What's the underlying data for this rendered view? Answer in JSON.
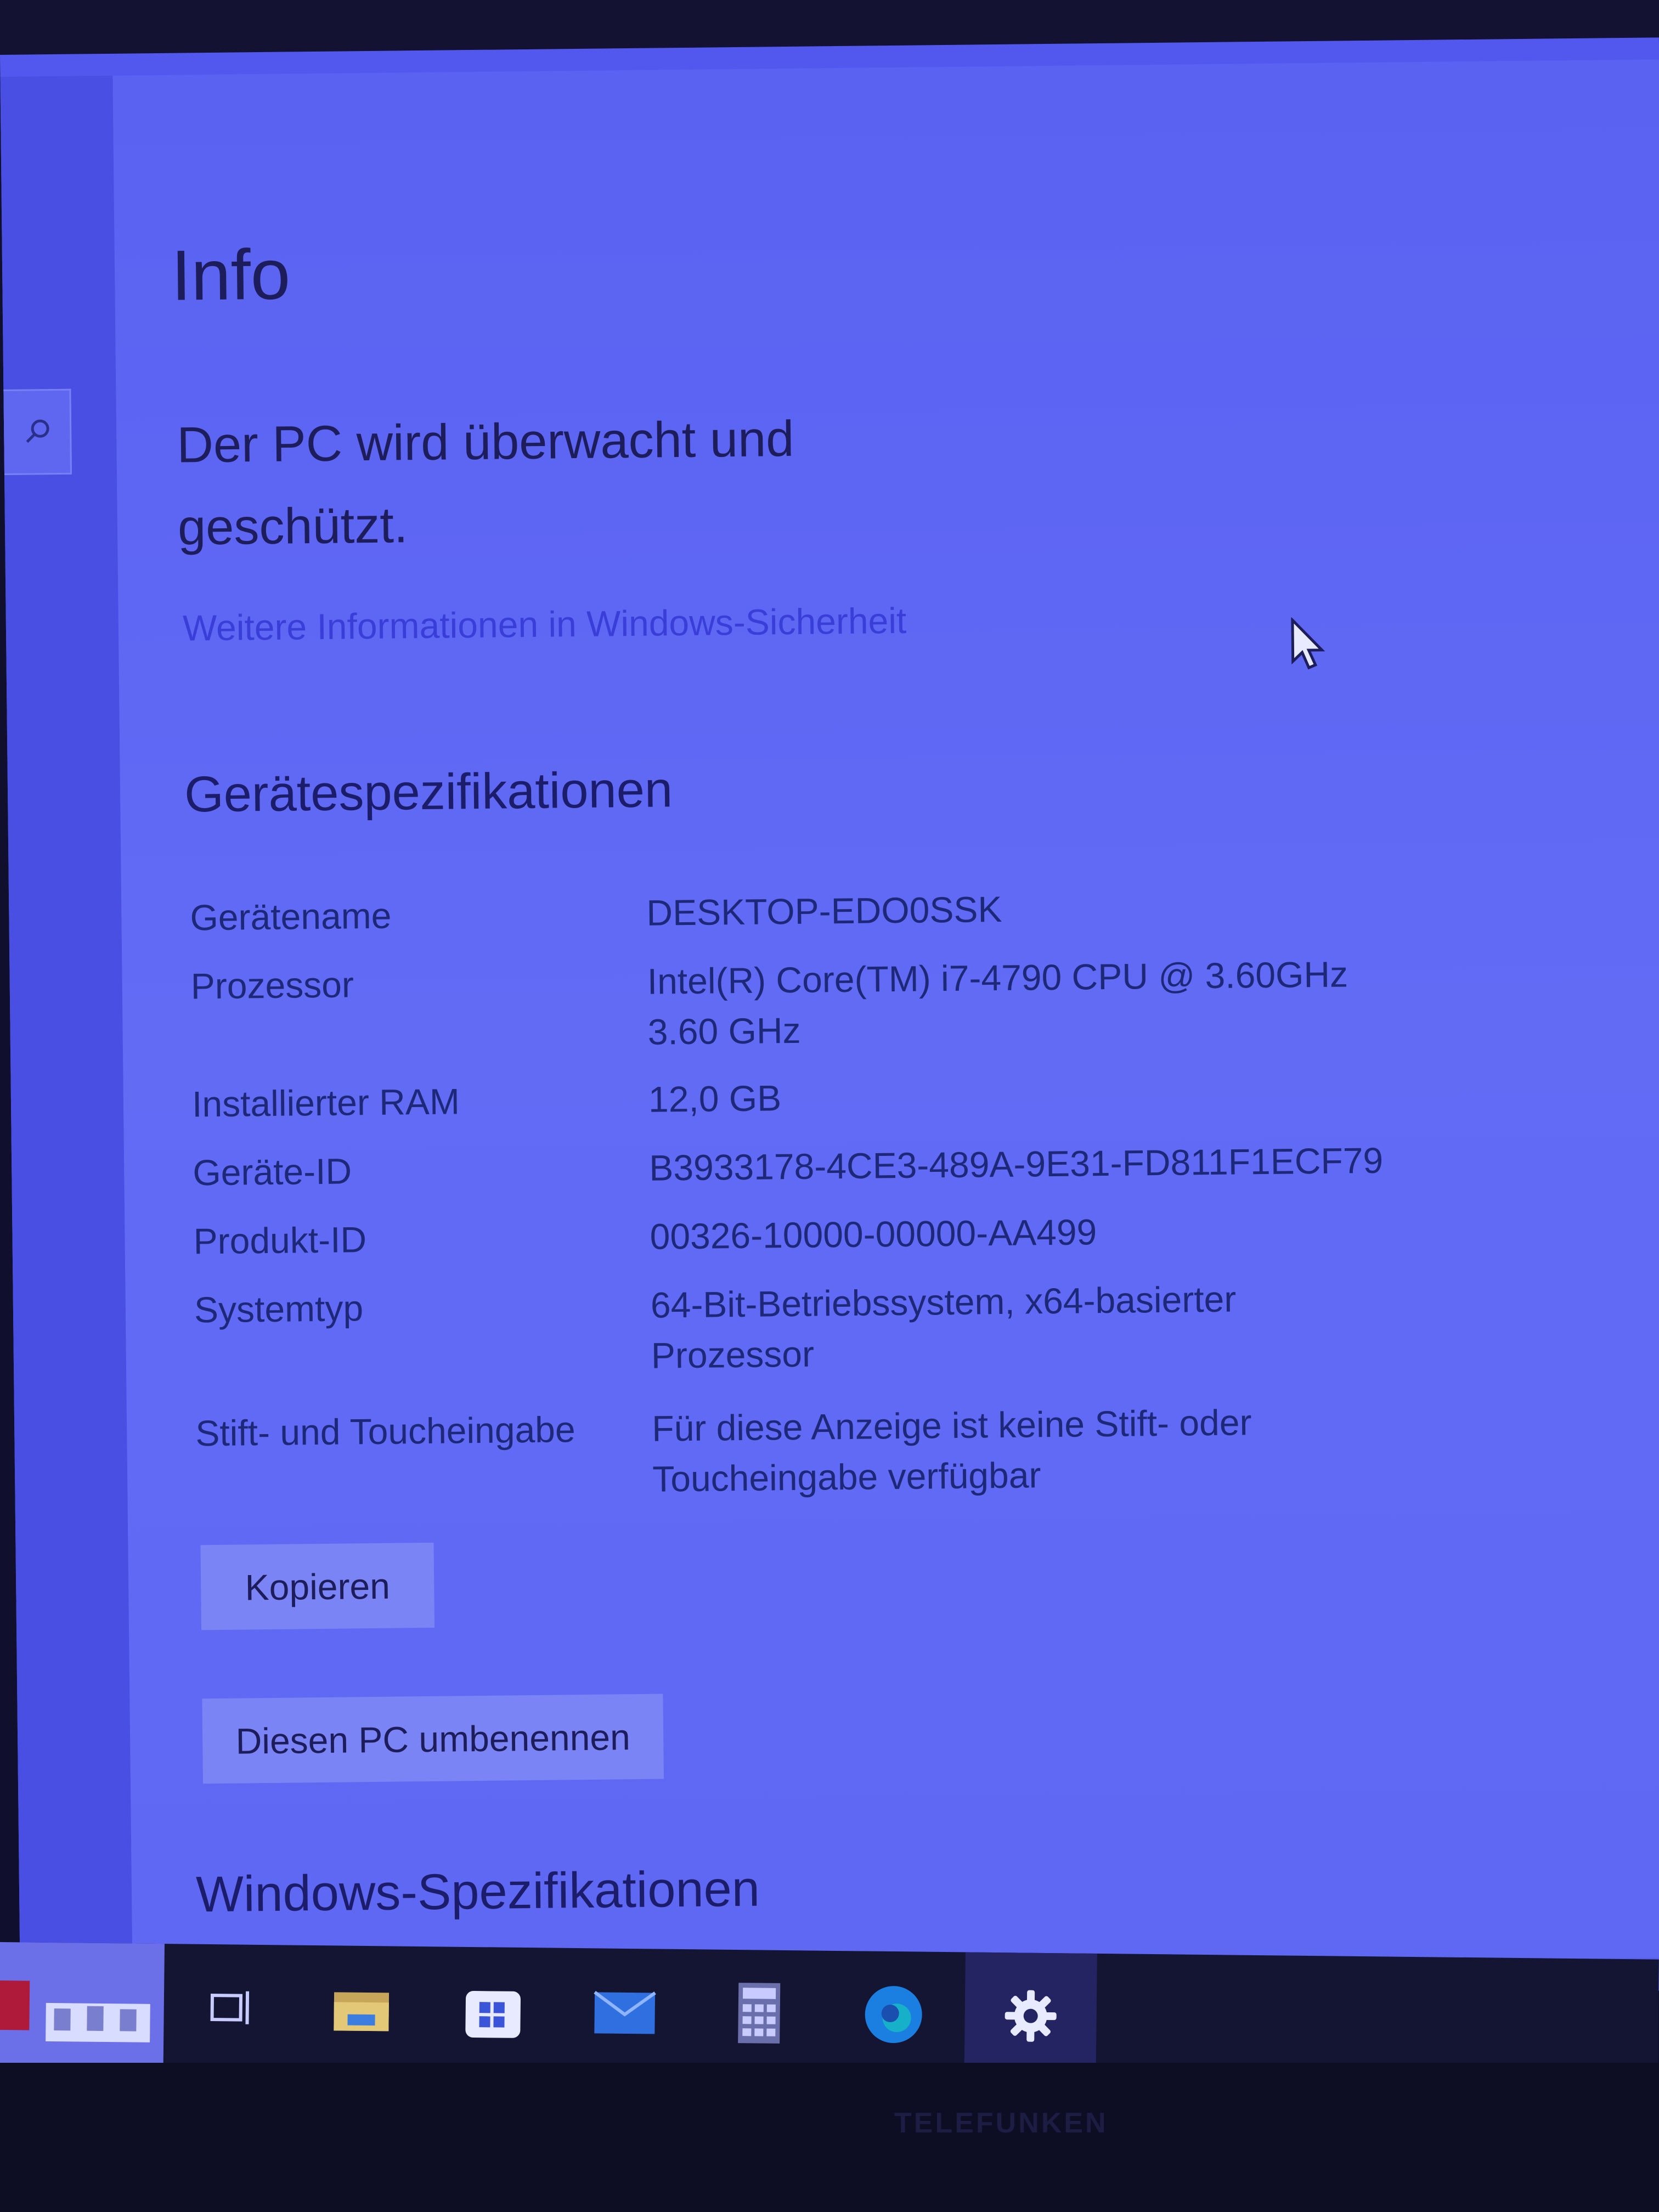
{
  "page": {
    "title": "Info",
    "status_text": "Der PC wird überwacht und geschützt.",
    "security_link": "Weitere Informationen in Windows-Sicherheit"
  },
  "device_specs": {
    "heading": "Gerätespezifikationen",
    "rows": [
      {
        "label": "Gerätename",
        "value": "DESKTOP-EDO0SSK"
      },
      {
        "label": "Prozessor",
        "value": "Intel(R) Core(TM) i7-4790 CPU @ 3.60GHz 3.60 GHz"
      },
      {
        "label": "Installierter RAM",
        "value": "12,0 GB"
      },
      {
        "label": "Geräte-ID",
        "value": "B3933178-4CE3-489A-9E31-FD811F1ECF79"
      },
      {
        "label": "Produkt-ID",
        "value": "00326-10000-00000-AA499"
      },
      {
        "label": "Systemtyp",
        "value": "64-Bit-Betriebssystem, x64-basierter Prozessor"
      },
      {
        "label": "Stift- und Toucheingabe",
        "value": "Für diese Anzeige ist keine Stift- oder Toucheingabe verfügbar"
      }
    ],
    "copy_button": "Kopieren",
    "rename_button": "Diesen PC umbenennen"
  },
  "windows_specs": {
    "heading": "Windows-Spezifikationen"
  },
  "taskbar": {
    "icons": [
      "task-view-icon",
      "file-explorer-icon",
      "store-icon",
      "mail-icon",
      "calculator-icon",
      "edge-icon",
      "settings-icon"
    ],
    "active": "settings-icon"
  },
  "monitor": {
    "brand": "TELEFUNKEN"
  },
  "colors": {
    "screen": "#5a62f2",
    "text": "#1c1d5a",
    "link": "#3a3ed8",
    "button": "#7b84f4",
    "taskbar": "#141433"
  }
}
